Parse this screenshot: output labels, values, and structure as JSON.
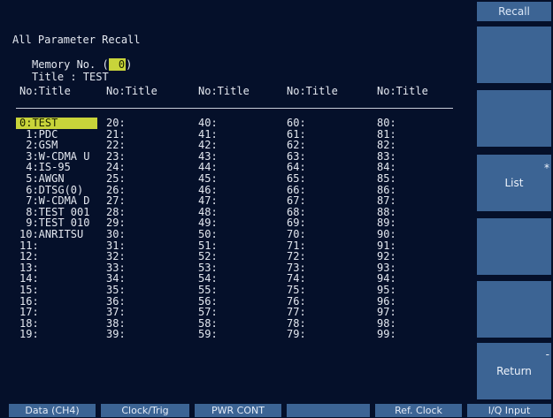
{
  "screen": {
    "title": "All Parameter Recall",
    "memory_label": "Memory No. (",
    "memory_value": " 0",
    "memory_close": ")",
    "title_line": "Title : TEST",
    "column_header": "No:Title"
  },
  "columns": [
    [
      "0:TEST",
      " 1:PDC",
      " 2:GSM",
      " 3:W-CDMA U",
      " 4:IS-95",
      " 5:AWGN",
      " 6:DTSG(0)",
      " 7:W-CDMA D",
      " 8:TEST 001",
      " 9:TEST 010",
      "10:ANRITSU",
      "11:",
      "12:",
      "13:",
      "14:",
      "15:",
      "16:",
      "17:",
      "18:",
      "19:"
    ],
    [
      "20:",
      "21:",
      "22:",
      "23:",
      "24:",
      "25:",
      "26:",
      "27:",
      "28:",
      "29:",
      "30:",
      "31:",
      "32:",
      "33:",
      "34:",
      "35:",
      "36:",
      "37:",
      "38:",
      "39:"
    ],
    [
      "40:",
      "41:",
      "42:",
      "43:",
      "44:",
      "45:",
      "46:",
      "47:",
      "48:",
      "49:",
      "50:",
      "51:",
      "52:",
      "53:",
      "54:",
      "55:",
      "56:",
      "57:",
      "58:",
      "59:"
    ],
    [
      "60:",
      "61:",
      "62:",
      "63:",
      "64:",
      "65:",
      "66:",
      "67:",
      "68:",
      "69:",
      "70:",
      "71:",
      "72:",
      "73:",
      "74:",
      "75:",
      "76:",
      "77:",
      "78:",
      "79:"
    ],
    [
      "80:",
      "81:",
      "82:",
      "83:",
      "84:",
      "85:",
      "86:",
      "87:",
      "88:",
      "89:",
      "90:",
      "91:",
      "92:",
      "93:",
      "94:",
      "95:",
      "96:",
      "97:",
      "98:",
      "99:"
    ]
  ],
  "softkeys": {
    "title": "Recall",
    "list_label": "List",
    "list_marker": "*",
    "return_label": "Return",
    "return_marker": "-"
  },
  "bottom_tabs": [
    "Data (CH4)",
    "Clock/Trig",
    "PWR CONT",
    "",
    "Ref. Clock",
    "I/Q Input"
  ],
  "colors": {
    "background": "#05102a",
    "highlight": "#c8d43a",
    "softkey": "#3c6494"
  }
}
